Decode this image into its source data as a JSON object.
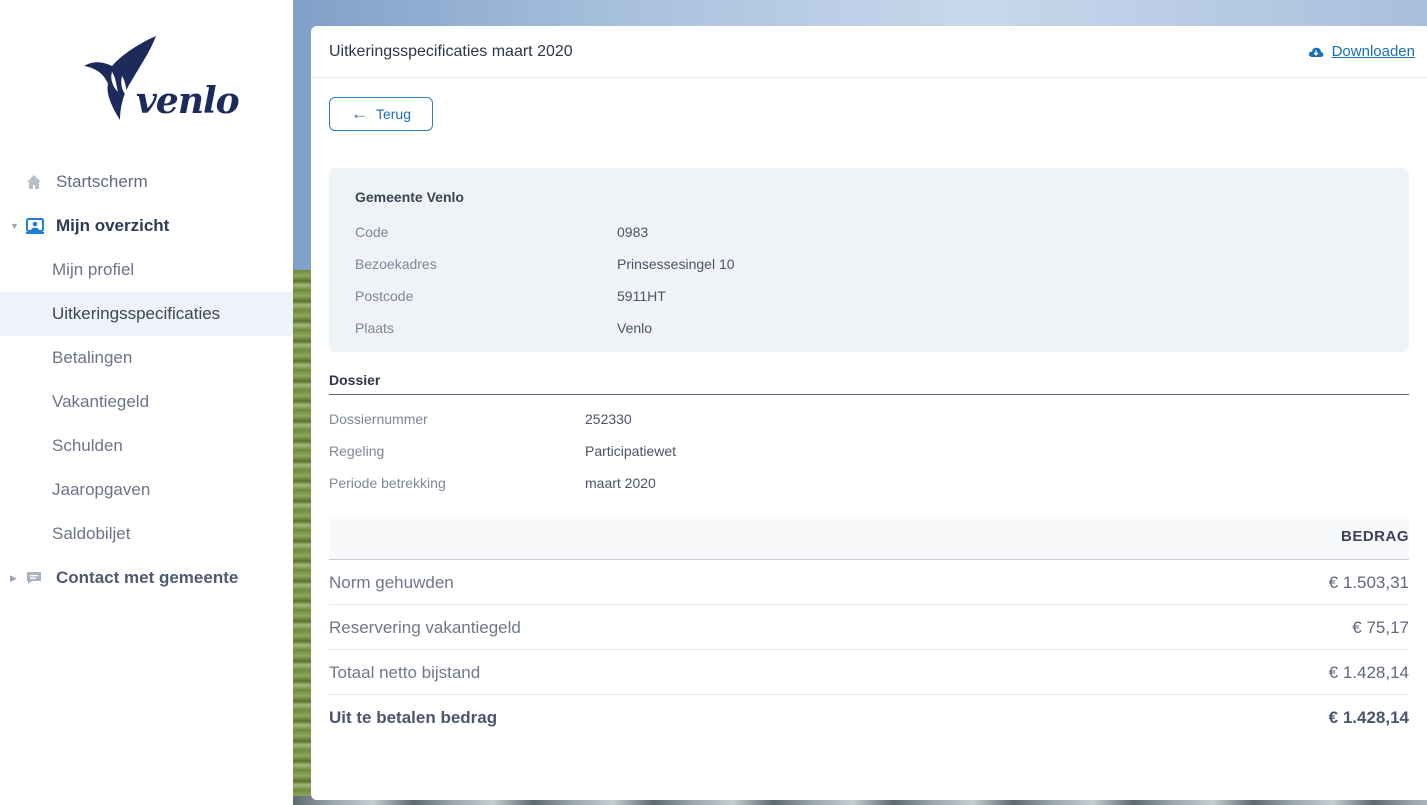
{
  "brand": {
    "logo_text": "venlo",
    "accent": "#1a6fb5",
    "logo_color": "#1d2a5c"
  },
  "sidebar": {
    "items": [
      {
        "label": "Startscherm",
        "type": "top",
        "icon": "home-icon"
      },
      {
        "label": "Mijn overzicht",
        "type": "top",
        "icon": "user-card-icon",
        "expanded": true
      },
      {
        "label": "Mijn profiel",
        "type": "sub"
      },
      {
        "label": "Uitkeringsspecificaties",
        "type": "sub",
        "active": true
      },
      {
        "label": "Betalingen",
        "type": "sub"
      },
      {
        "label": "Vakantiegeld",
        "type": "sub"
      },
      {
        "label": "Schulden",
        "type": "sub"
      },
      {
        "label": "Jaaropgaven",
        "type": "sub"
      },
      {
        "label": "Saldobiljet",
        "type": "sub"
      },
      {
        "label": "Contact met gemeente",
        "type": "top",
        "icon": "chat-icon",
        "expanded": false
      }
    ]
  },
  "card": {
    "title": "Uitkeringsspecificaties maart 2020",
    "download_label": "Downloaden",
    "back_label": "Terug"
  },
  "gemeente": {
    "heading": "Gemeente Venlo",
    "rows": [
      {
        "label": "Code",
        "value": "0983"
      },
      {
        "label": "Bezoekadres",
        "value": "Prinsessesingel 10"
      },
      {
        "label": "Postcode",
        "value": "5911HT"
      },
      {
        "label": "Plaats",
        "value": "Venlo"
      }
    ]
  },
  "dossier": {
    "heading": "Dossier",
    "rows": [
      {
        "label": "Dossiernummer",
        "value": "252330"
      },
      {
        "label": "Regeling",
        "value": "Participatiewet"
      },
      {
        "label": "Periode betrekking",
        "value": "maart 2020"
      }
    ]
  },
  "amounts": {
    "column_header": "BEDRAG",
    "rows": [
      {
        "label": "Norm gehuwden",
        "value": "€ 1.503,31"
      },
      {
        "label": "Reservering vakantiegeld",
        "value": "€ 75,17"
      },
      {
        "label": "Totaal netto bijstand",
        "value": "€ 1.428,14"
      }
    ],
    "total": {
      "label": "Uit te betalen bedrag",
      "value": "€ 1.428,14"
    }
  }
}
